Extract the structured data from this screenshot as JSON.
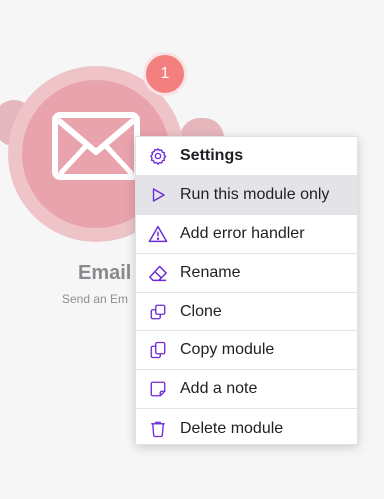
{
  "module": {
    "badge_count": "1",
    "title": "Email",
    "subtitle": "Send an Em",
    "color": "#e9a3ad"
  },
  "menu": {
    "accent_color": "#6b2bd9",
    "items": [
      {
        "label": "Settings",
        "icon": "gear-icon"
      },
      {
        "label": "Run this module only",
        "icon": "play-icon"
      },
      {
        "label": "Add error handler",
        "icon": "warning-icon"
      },
      {
        "label": "Rename",
        "icon": "eraser-icon"
      },
      {
        "label": "Clone",
        "icon": "clone-icon"
      },
      {
        "label": "Copy module",
        "icon": "copy-icon"
      },
      {
        "label": "Add a note",
        "icon": "note-icon"
      },
      {
        "label": "Delete module",
        "icon": "trash-icon"
      }
    ]
  }
}
